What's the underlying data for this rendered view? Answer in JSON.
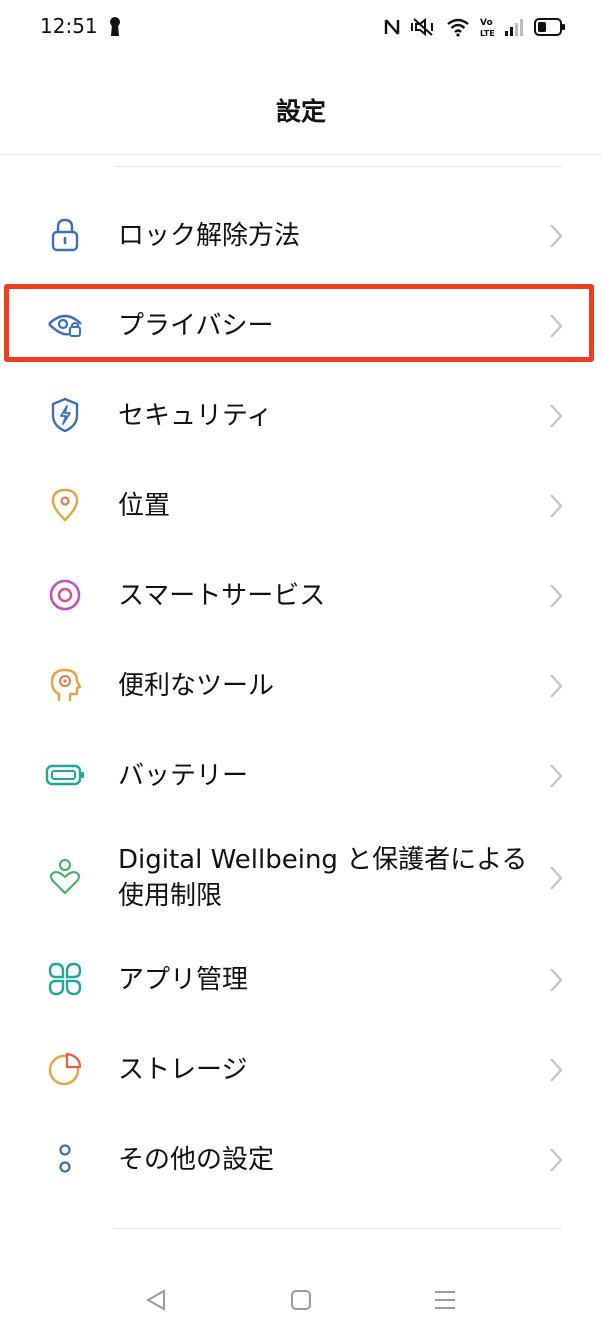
{
  "status_bar": {
    "time": "12:51"
  },
  "header": {
    "title": "設定"
  },
  "settings": [
    {
      "label": "ロック解除方法",
      "icon": "lock-icon",
      "color": "#3d6fb6"
    },
    {
      "label": "プライバシー",
      "icon": "privacy-eye-icon",
      "color": "#3d6fb6"
    },
    {
      "label": "セキュリティ",
      "icon": "security-shield-icon",
      "color": "#3d6fb6"
    },
    {
      "label": "位置",
      "icon": "location-pin-icon",
      "color": "#e8a33a"
    },
    {
      "label": "スマートサービス",
      "icon": "smart-services-icon",
      "color": "#c44fc8"
    },
    {
      "label": "便利なツール",
      "icon": "convenient-tools-icon",
      "color": "#e8a33a"
    },
    {
      "label": "バッテリー",
      "icon": "battery-icon",
      "color": "#1fa89a"
    },
    {
      "label": "Digital Wellbeing と保護者による使用制限",
      "icon": "wellbeing-heart-icon",
      "color": "#4caf6e"
    },
    {
      "label": "アプリ管理",
      "icon": "app-management-icon",
      "color": "#1fa89a"
    },
    {
      "label": "ストレージ",
      "icon": "storage-pie-icon",
      "color": "#e8a33a"
    },
    {
      "label": "その他の設定",
      "icon": "more-settings-icon",
      "color": "#3d6fb6"
    }
  ],
  "highlight": {
    "color": "#f23a1c",
    "target": "プライバシー"
  },
  "nav_bar": {
    "back": "back-triangle-icon",
    "home": "home-square-icon",
    "recents": "menu-lines-icon"
  }
}
